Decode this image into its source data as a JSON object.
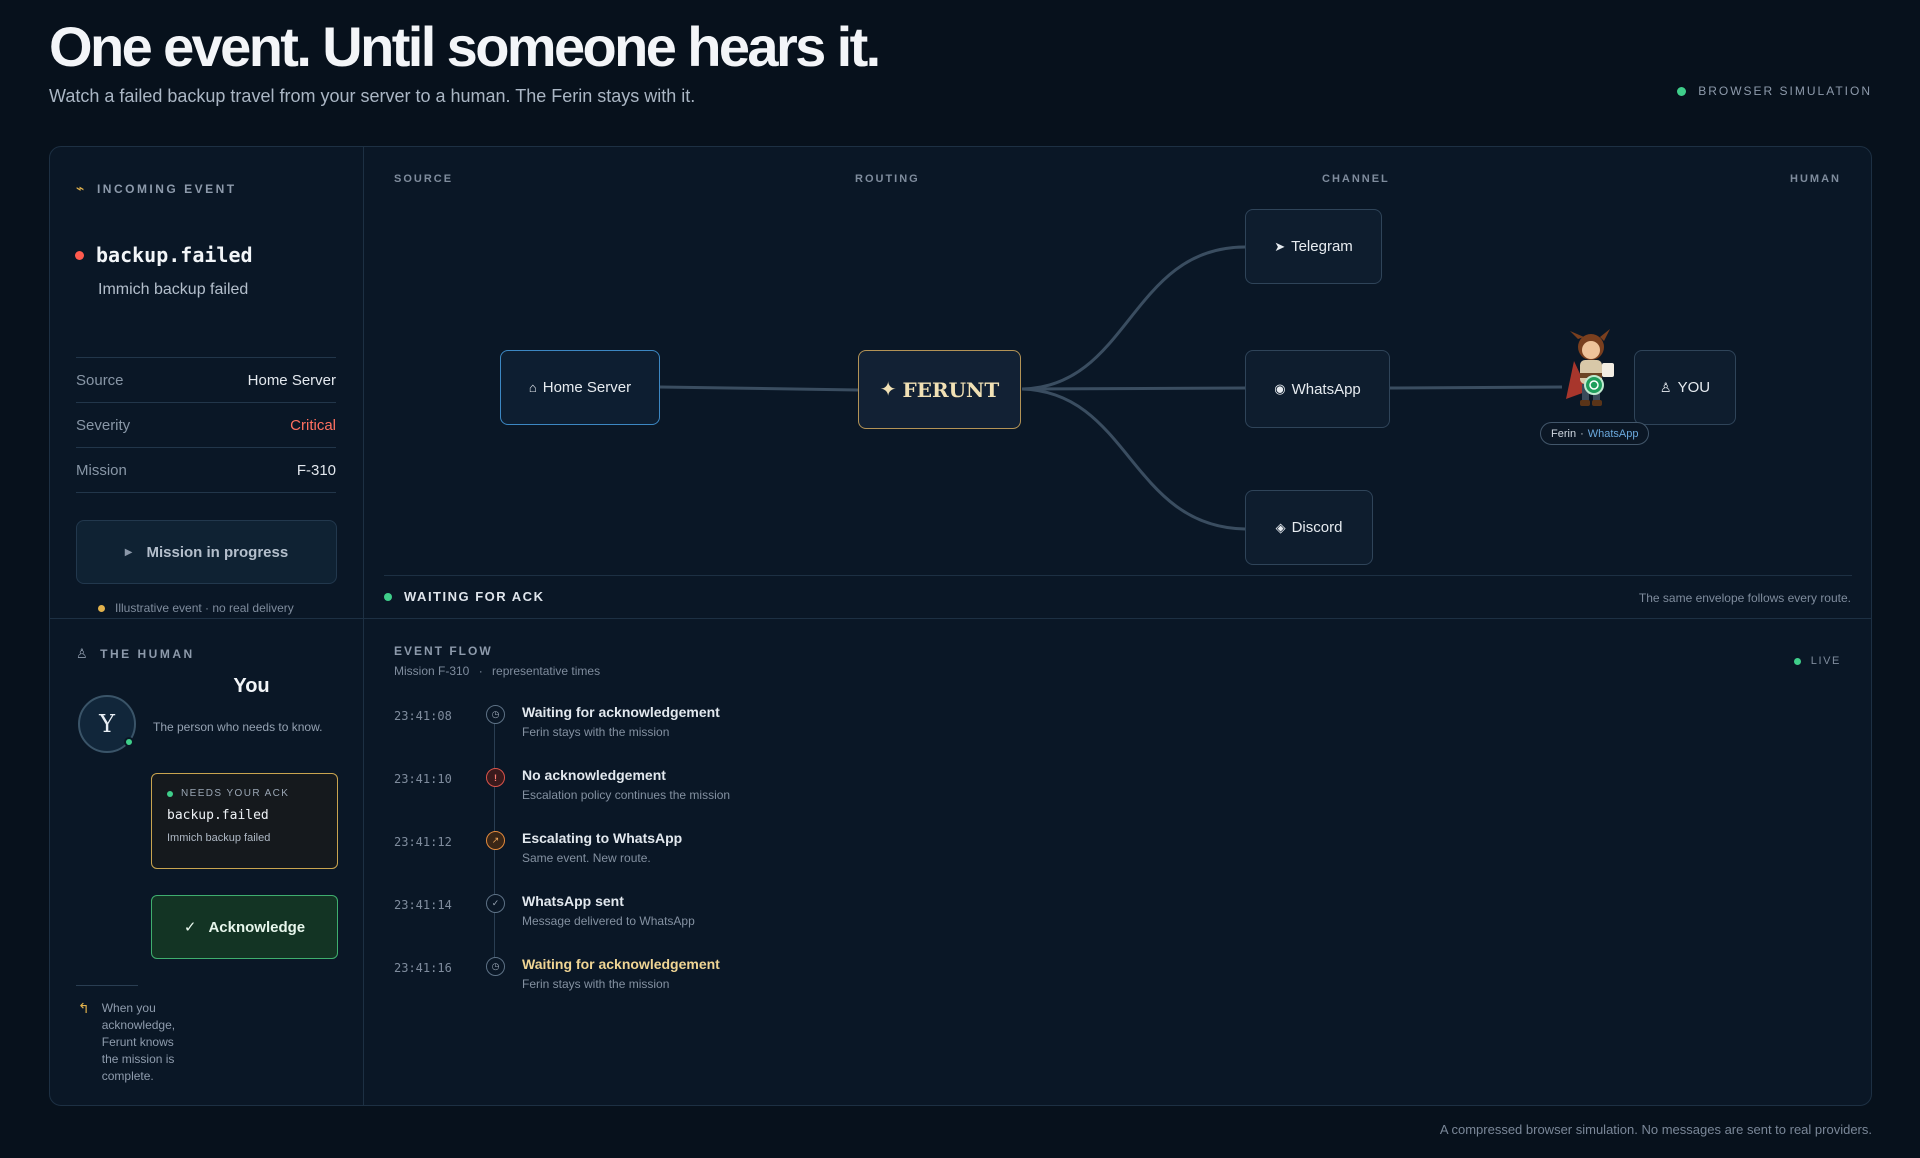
{
  "header": {
    "title": "One event. Until someone hears it.",
    "subtitle": "Watch a failed backup travel from your server to a human. The Ferin stays with it.",
    "sim_badge": "BROWSER SIMULATION"
  },
  "incoming": {
    "label": "INCOMING EVENT",
    "event_name": "backup.failed",
    "event_desc": "Immich backup failed",
    "meta": [
      {
        "key": "Source",
        "value": "Home Server"
      },
      {
        "key": "Severity",
        "value": "Critical"
      },
      {
        "key": "Mission",
        "value": "F-310"
      }
    ],
    "mission_button": "Mission in progress",
    "illustrative_note": "Illustrative event · no real delivery"
  },
  "routing": {
    "columns": {
      "source": "SOURCE",
      "routing": "ROUTING",
      "channel": "CHANNEL",
      "human": "HUMAN"
    },
    "nodes": {
      "home_server": "Home Server",
      "ferunt": "FERUNT",
      "telegram": "Telegram",
      "whatsapp": "WhatsApp",
      "discord": "Discord",
      "you": "YOU"
    },
    "ferin_label_name": "Ferin",
    "ferin_label_sep": "·",
    "ferin_label_channel": "WhatsApp",
    "status": "WAITING FOR ACK",
    "envelope_note": "The same envelope follows every route."
  },
  "human": {
    "label": "THE HUMAN",
    "name": "You",
    "avatar_letter": "Y",
    "description": "The person who needs to know.",
    "ack_card": {
      "head": "NEEDS YOUR ACK",
      "event": "backup.failed",
      "desc": "Immich backup failed"
    },
    "ack_button": "Acknowledge",
    "hint": "When you acknowledge, Ferunt knows the mission is complete."
  },
  "event_flow": {
    "title": "EVENT FLOW",
    "mission": "Mission F-310",
    "mission_sep": "·",
    "mission_note": "representative times",
    "live_label": "LIVE",
    "items": [
      {
        "time": "23:41:08",
        "title": "Waiting for acknowledgement",
        "desc": "Ferin stays with the mission",
        "icon": "clock-icon"
      },
      {
        "time": "23:41:10",
        "title": "No acknowledgement",
        "desc": "Escalation policy continues the mission",
        "icon": "alert-icon"
      },
      {
        "time": "23:41:12",
        "title": "Escalating to WhatsApp",
        "desc": "Same event. New route.",
        "icon": "escalate-icon"
      },
      {
        "time": "23:41:14",
        "title": "WhatsApp sent",
        "desc": "Message delivered to WhatsApp",
        "icon": "check-icon"
      },
      {
        "time": "23:41:16",
        "title": "Waiting for acknowledgement",
        "desc": "Ferin stays with the mission",
        "icon": "clock-icon"
      }
    ]
  },
  "footer": {
    "note": "A compressed browser simulation. No messages are sent to real providers."
  },
  "colors": {
    "background": "#07111c",
    "panel": "#0a1726",
    "accent_gold": "#c9a44f",
    "success_green": "#3fce8a",
    "critical_red": "#ff7060",
    "home_server_border": "#3c87c2"
  }
}
